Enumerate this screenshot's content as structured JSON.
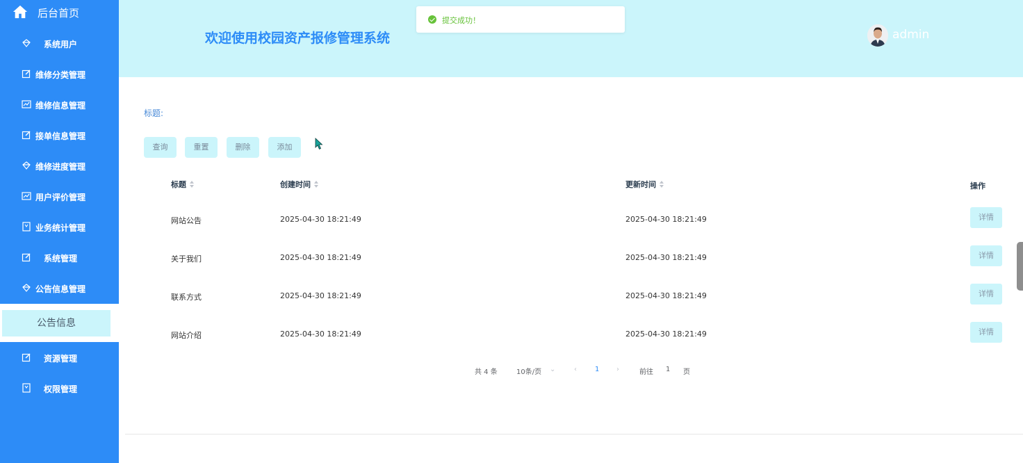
{
  "sidebar": {
    "home_label": "后台首页",
    "items": [
      {
        "label": "系统用户",
        "icon": "diamond-icon"
      },
      {
        "label": "维修分类管理",
        "icon": "edit-icon"
      },
      {
        "label": "维修信息管理",
        "icon": "chart-icon"
      },
      {
        "label": "接单信息管理",
        "icon": "edit-icon"
      },
      {
        "label": "维修进度管理",
        "icon": "diamond-icon"
      },
      {
        "label": "用户评价管理",
        "icon": "chart-icon"
      },
      {
        "label": "业务统计管理",
        "icon": "bookmark-icon"
      },
      {
        "label": "系统管理",
        "icon": "edit-icon"
      },
      {
        "label": "公告信息管理",
        "icon": "diamond-icon"
      },
      {
        "label": "资源管理",
        "icon": "edit-icon"
      },
      {
        "label": "权限管理",
        "icon": "bookmark-icon"
      }
    ],
    "active_sub_item": "公告信息"
  },
  "header": {
    "title": "欢迎使用校园资产报修管理系统",
    "username": "admin"
  },
  "toast": {
    "message": "提交成功！",
    "type": "success"
  },
  "filter": {
    "title_label": "标题:"
  },
  "toolbar": {
    "query": "查询",
    "reset": "重置",
    "delete": "删除",
    "add": "添加"
  },
  "table": {
    "columns": [
      "标题",
      "创建时间",
      "更新时间",
      "操作"
    ],
    "rows": [
      {
        "title": "网站公告",
        "created": "2025-04-30 18:21:49",
        "updated": "2025-04-30 18:21:49",
        "action": "详情"
      },
      {
        "title": "关于我们",
        "created": "2025-04-30 18:21:49",
        "updated": "2025-04-30 18:21:49",
        "action": "详情"
      },
      {
        "title": "联系方式",
        "created": "2025-04-30 18:21:49",
        "updated": "2025-04-30 18:21:49",
        "action": "详情"
      },
      {
        "title": "网站介绍",
        "created": "2025-04-30 18:21:49",
        "updated": "2025-04-30 18:21:49",
        "action": "详情"
      }
    ]
  },
  "pagination": {
    "total": "共 4 条",
    "page_size": "10条/页",
    "current_page": "1",
    "goto_label": "前往",
    "goto_value": "1",
    "page_suffix": "页"
  },
  "colors": {
    "sidebar": "#2d8cf7",
    "header": "#cbf5fb",
    "success": "#67c23a"
  }
}
